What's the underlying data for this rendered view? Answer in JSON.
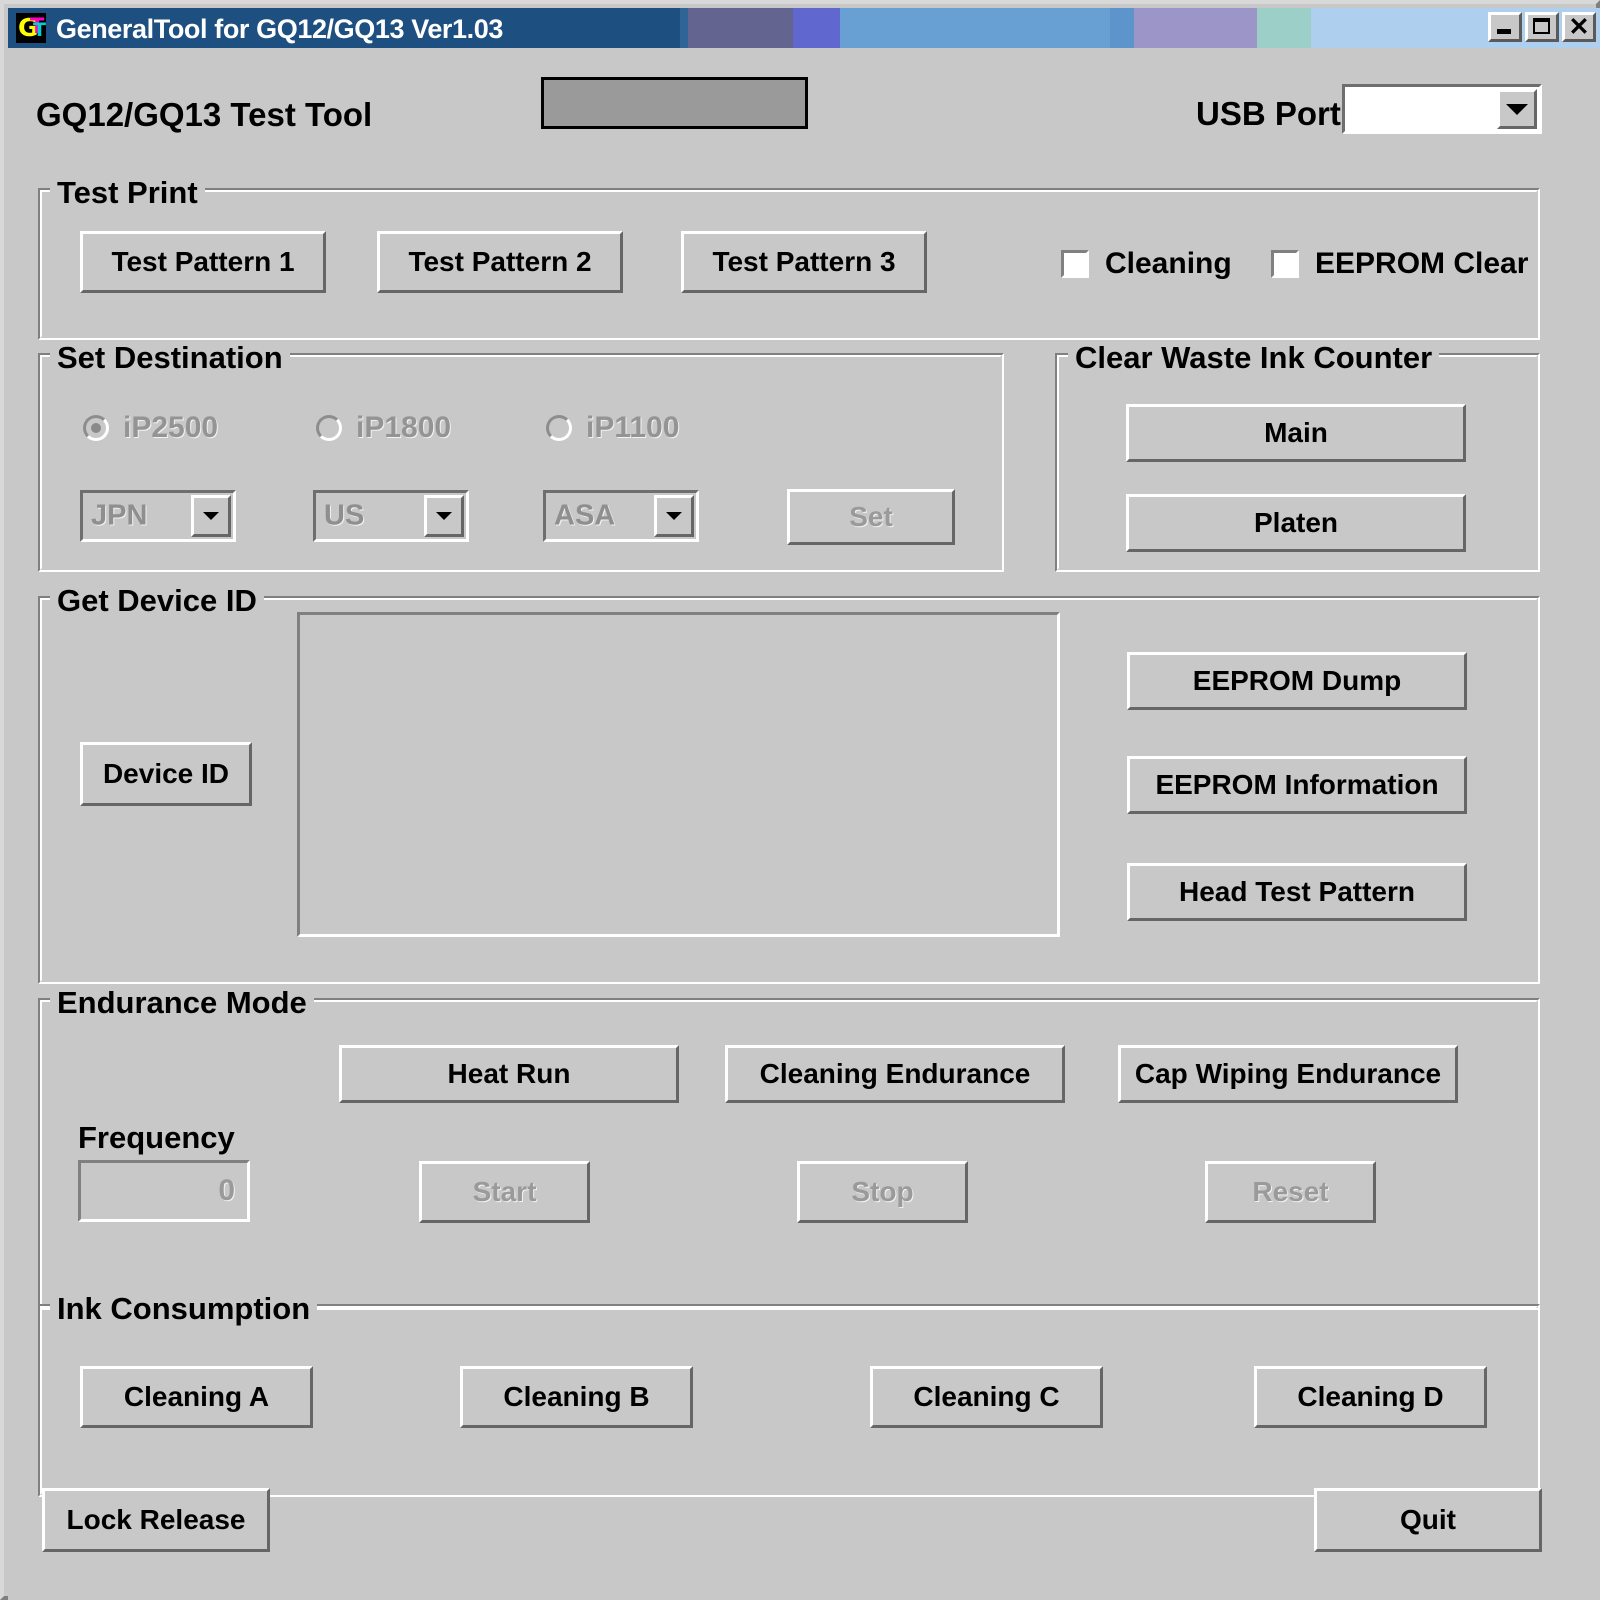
{
  "window": {
    "title": "GeneralTool for GQ12/GQ13 Ver1.03",
    "icon_name": "app-icon-gt",
    "minimize_label": "_",
    "maximize_label": "□",
    "close_label": "✕",
    "titlebar_bands": [
      "#1d4f80",
      "#2e6596",
      "#646490",
      "#6067cf",
      "#69a0d4",
      "#5e94cc",
      "#9b95c8",
      "#9ccfc7",
      "#aed0ee"
    ]
  },
  "header": {
    "app_label": "GQ12/GQ13 Test Tool",
    "status_panel_value": "",
    "usb_port_label": "USB Port",
    "usb_port_value": "",
    "usb_port_options": []
  },
  "test_print": {
    "title": "Test Print",
    "buttons": [
      {
        "label": "Test Pattern 1"
      },
      {
        "label": "Test Pattern 2"
      },
      {
        "label": "Test Pattern 3"
      }
    ],
    "checkboxes": [
      {
        "label": "Cleaning",
        "checked": false
      },
      {
        "label": "EEPROM Clear",
        "checked": false
      }
    ]
  },
  "set_destination": {
    "title": "Set Destination",
    "enabled": false,
    "radios": [
      {
        "label": "iP2500",
        "checked": true
      },
      {
        "label": "iP1800",
        "checked": false
      },
      {
        "label": "iP1100",
        "checked": false
      }
    ],
    "combos": [
      {
        "value": "JPN"
      },
      {
        "value": "US"
      },
      {
        "value": "ASA"
      }
    ],
    "set_button": "Set"
  },
  "clear_waste_ink_counter": {
    "title": "Clear Waste Ink Counter",
    "buttons": [
      {
        "label": "Main"
      },
      {
        "label": "Platen"
      }
    ]
  },
  "get_device_id": {
    "title": "Get Device ID",
    "device_id_button": "Device ID",
    "output_value": "",
    "side_buttons": [
      {
        "label": "EEPROM Dump"
      },
      {
        "label": "EEPROM Information"
      },
      {
        "label": "Head Test Pattern"
      }
    ]
  },
  "endurance_mode": {
    "title": "Endurance Mode",
    "buttons": [
      {
        "label": "Heat Run"
      },
      {
        "label": "Cleaning Endurance"
      },
      {
        "label": "Cap Wiping Endurance"
      }
    ],
    "frequency_label": "Frequency",
    "frequency_value": "0",
    "control_buttons": [
      {
        "label": "Start"
      },
      {
        "label": "Stop"
      },
      {
        "label": "Reset"
      }
    ]
  },
  "ink_consumption": {
    "title": "Ink Consumption",
    "buttons": [
      {
        "label": "Cleaning A"
      },
      {
        "label": "Cleaning B"
      },
      {
        "label": "Cleaning C"
      },
      {
        "label": "Cleaning D"
      }
    ]
  },
  "footer": {
    "lock_release_label": "Lock Release",
    "quit_label": "Quit"
  }
}
